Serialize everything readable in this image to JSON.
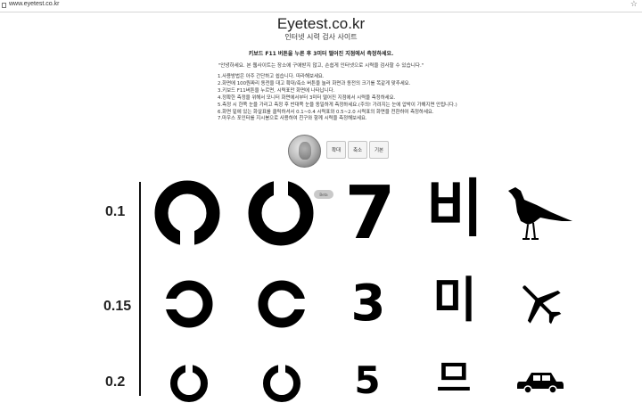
{
  "browser": {
    "url": "www.eyetest.co.kr",
    "icons": [
      "page-icon",
      "star-icon"
    ]
  },
  "header": {
    "title": "Eyetest.co.kr",
    "subtitle": "인터넷 시력 검사 사이트"
  },
  "instruction": "키보드 F11 버튼을 누른 후 3미터 떨어진 지점에서 측정하세요.",
  "greeting": "\"안녕하세요. 본 웹사이트는 장소에 구애받지 않고, 손쉽게 인터넷으로 시력을 검사할 수 있습니다.\"",
  "rules": [
    "1.사용방법은 아주 간단하고 쉽습니다. 따라해보세요.",
    "2.화면에 100원짜리 동전을 대고 확대/축소 버튼을 눌러 화면과 동전의 크기를 똑같게 맞추세요.",
    "3.키보드 F11버튼을 누르면, 시력표만 화면에 나타납니다.",
    "4.정확한 측정을 위해서 모니터 화면에서부터 3미터 떨어진 지점에서 시력을 측정하세요.",
    "5.측정 시 한쪽 눈을 가리고 측정 후 반대쪽 눈을 동일하게 측정하세요.(주의! 가려지는 눈에 압박이 가해지면 안됩니다.)",
    "6.화면 밑에 있는 화살표를 클릭하셔서 0.1~0.4 시력표와 0.5~2.0 시력표의 화면을 전환하여 측정하세요.",
    "7.마우스 포인터를 지시봉으로 사용하여 친구와 함께 시력을 측정해보세요."
  ],
  "controls": {
    "zoom_in": "확대",
    "zoom_out": "축소",
    "reset": "기본"
  },
  "tag": "Beta",
  "chart": {
    "rows": [
      {
        "acuity": "0.1",
        "chars": [
          "7",
          "비"
        ],
        "icons": [
          "landolt-ring-gap-bottom",
          "landolt-ring-gap-top",
          "bird-icon"
        ]
      },
      {
        "acuity": "0.15",
        "chars": [
          "3",
          "미"
        ],
        "icons": [
          "landolt-ring-gap-left",
          "landolt-ring-gap-right",
          "airplane-icon"
        ]
      },
      {
        "acuity": "0.2",
        "chars": [
          "5",
          "므"
        ],
        "icons": [
          "landolt-ring-gap-top",
          "landolt-ring-gap-top",
          "car-icon"
        ]
      }
    ]
  }
}
